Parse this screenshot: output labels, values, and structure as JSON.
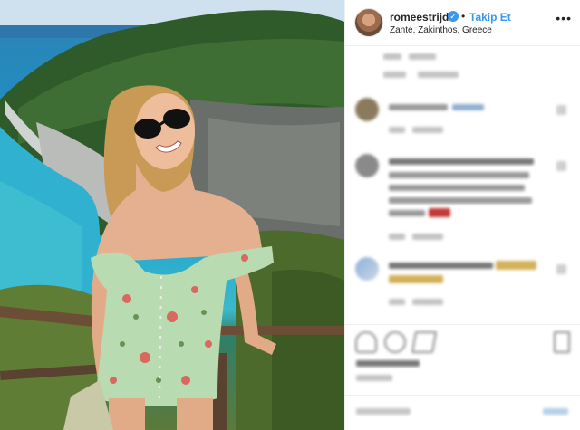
{
  "header": {
    "username": "romeestrijd",
    "verified_icon": "verified-badge-icon",
    "separator": "•",
    "follow_label": "Takip Et",
    "location": "Zante, Zakinthos, Greece",
    "more_icon": "more-options-icon",
    "more_label": "•••"
  },
  "comments_blurred": true,
  "colors": {
    "accent": "#3897f0",
    "text": "#262626",
    "divider": "#efefef"
  },
  "actions": {
    "icons": [
      "heart-icon",
      "comment-icon",
      "share-icon",
      "bookmark-icon"
    ]
  }
}
